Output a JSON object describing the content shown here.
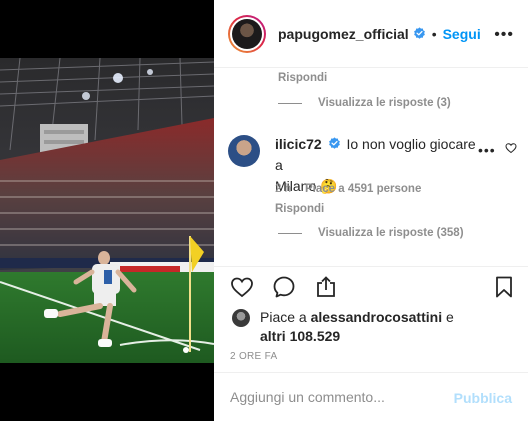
{
  "post": {
    "author": "papugomez_official",
    "follow_label": "Segui",
    "separator": "•",
    "more": "•••",
    "image_alt_icon": "stadium-photo"
  },
  "comments": {
    "prev_reply": "Rispondi",
    "prev_view_replies": "Visualizza le risposte (3)",
    "main": {
      "user": "ilicic72",
      "text_line1": "Io non voglio giocare a",
      "text_line2": "Milano",
      "emoji": "🤔",
      "time": "2 h",
      "likes": "Piace a 4591 persone",
      "reply": "Rispondi",
      "view_replies": "Visualizza le risposte (358)"
    }
  },
  "likes": {
    "prefix": "Piace a ",
    "user": "alessandrocosattini",
    "conj": " e",
    "others": "altri 108.529"
  },
  "timestamp": "2 ORE FA",
  "composer": {
    "placeholder": "Aggiungi un commento...",
    "publish": "Pubblica"
  },
  "colors": {
    "link": "#0095f6",
    "publish_disabled": "#b2dffc",
    "muted": "#8e8e8e",
    "text": "#262626"
  }
}
